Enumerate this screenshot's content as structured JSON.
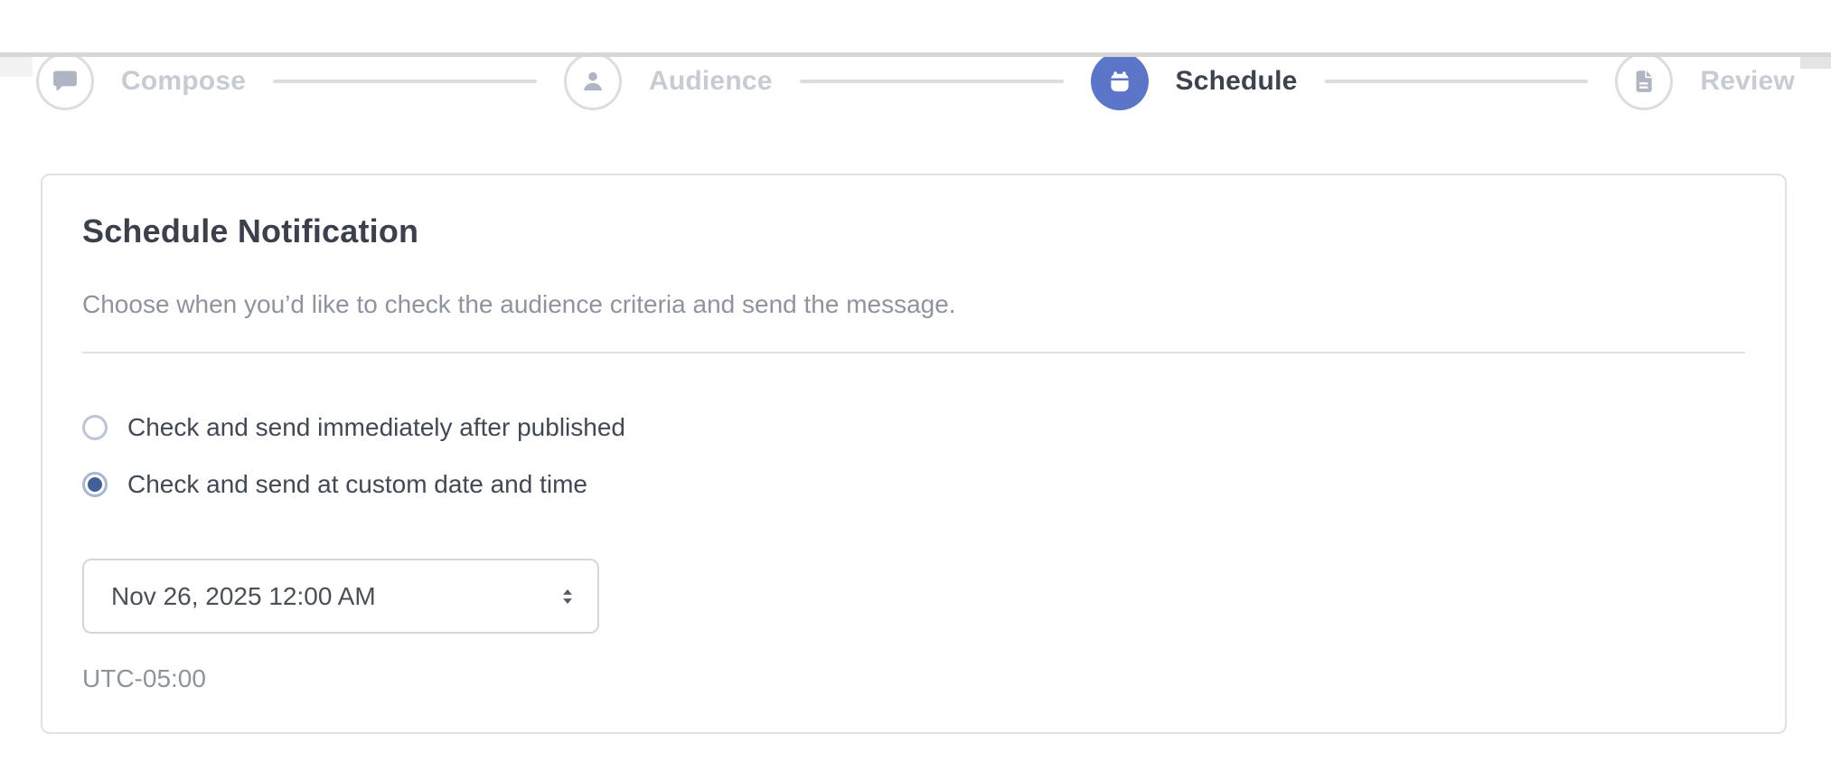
{
  "stepper": {
    "steps": [
      {
        "label": "Compose",
        "icon": "chat-bubble-icon",
        "state": "inactive"
      },
      {
        "label": "Audience",
        "icon": "user-icon",
        "state": "inactive"
      },
      {
        "label": "Schedule",
        "icon": "calendar-icon",
        "state": "active"
      },
      {
        "label": "Review",
        "icon": "document-icon",
        "state": "inactive"
      }
    ]
  },
  "card": {
    "title": "Schedule Notification",
    "subtitle": "Choose when you’d like to check the audience criteria and send the message.",
    "options": [
      {
        "label": "Check and send immediately after published",
        "selected": false
      },
      {
        "label": "Check and send at custom date and time",
        "selected": true
      }
    ],
    "datetime_select": {
      "value": "Nov 26, 2025 12:00 AM"
    },
    "timezone": "UTC-05:00"
  },
  "colors": {
    "accent": "#5B75C8",
    "active_label": "#3C434E",
    "inactive_label": "#C6CBD4",
    "icon_gray": "#AFB5C2",
    "circle_border": "#DADDE2",
    "line": "#DADDE2",
    "card_border": "#DFE1E4",
    "heading": "#3A414C",
    "muted": "#8D949F",
    "body_text": "#414956",
    "radio_border": "#BCC6D8",
    "radio_border_sel": "#A9B6D0",
    "radio_dot": "#40609A",
    "select_border": "#D4D6DA",
    "select_text": "#4A5059",
    "arrow": "#555B64"
  }
}
